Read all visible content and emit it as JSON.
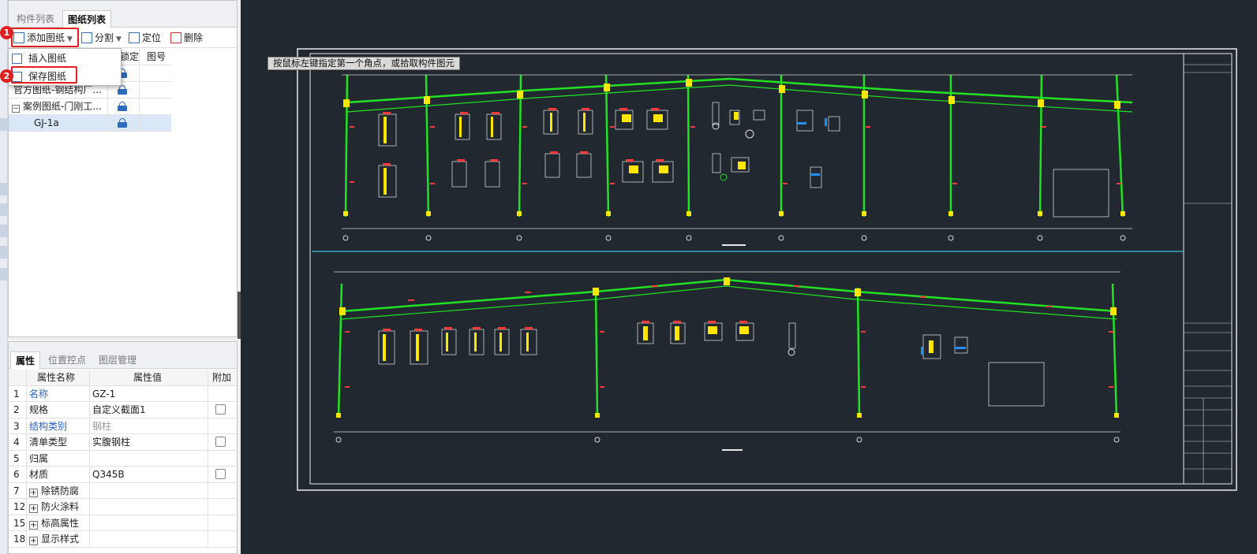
{
  "top_panel": {
    "tabs": [
      "构件列表",
      "图纸列表"
    ],
    "active_tab": 1,
    "close_glyph": "×",
    "toolbar": {
      "add_drawing": "添加图纸",
      "split": "分割",
      "locate": "定位",
      "delete": "删除"
    },
    "dropdown": {
      "insert_drawing": "插入图纸",
      "save_drawing": "保存图纸"
    },
    "step_badges": [
      "1",
      "2"
    ],
    "table": {
      "headers": [
        "锁定",
        "图号"
      ],
      "rows": [
        {
          "name": "",
          "expander": ""
        },
        {
          "name": "官方图纸-钢结构厂...",
          "expander": ""
        },
        {
          "name": "案例图纸-门刚工...",
          "expander": "−"
        },
        {
          "name": "GJ-1a",
          "expander": ""
        }
      ]
    }
  },
  "bottom_panel": {
    "tabs": [
      "属性",
      "位置控点",
      "图层管理"
    ],
    "close_glyph": "×",
    "headers": [
      "属性名称",
      "属性值",
      "附加"
    ],
    "rows": [
      {
        "no": "1",
        "name": "名称",
        "value": "GZ-1",
        "plus": false
      },
      {
        "no": "2",
        "name": "规格",
        "value": "自定义截面1",
        "plus": false
      },
      {
        "no": "3",
        "name": "结构类别",
        "value": "钢柱",
        "plus": false
      },
      {
        "no": "4",
        "name": "清单类型",
        "value": "实腹钢柱",
        "plus": false
      },
      {
        "no": "5",
        "name": "归属",
        "value": "",
        "plus": false
      },
      {
        "no": "6",
        "name": "材质",
        "value": "Q345B",
        "plus": false
      },
      {
        "no": "7",
        "name": "除锈防腐",
        "value": "",
        "plus": true
      },
      {
        "no": "12",
        "name": "防火涂料",
        "value": "",
        "plus": true
      },
      {
        "no": "15",
        "name": "标高属性",
        "value": "",
        "plus": true
      },
      {
        "no": "18",
        "name": "显示样式",
        "value": "",
        "plus": true
      }
    ]
  },
  "canvas": {
    "prompt": "按鼠标左键指定第一个角点，或拾取构件图元",
    "background": "#212830",
    "frame_color": "#22e322",
    "divider_color": "#2fc0d8"
  },
  "icons": {
    "add_drawing": "add-drawing-icon",
    "split": "split-icon",
    "locate": "locate-icon",
    "delete": "delete-icon",
    "lock": "unlock-icon"
  }
}
